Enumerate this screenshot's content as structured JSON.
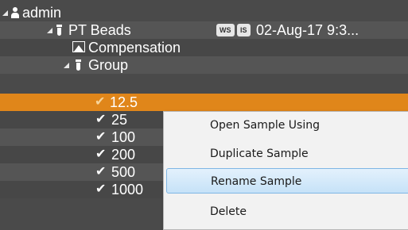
{
  "tree": {
    "root": {
      "label": "admin",
      "icon": "person-icon"
    },
    "experiment": {
      "label": "PT Beads",
      "icon": "tube-icon",
      "badges": [
        "WS",
        "IS"
      ],
      "date": "02-Aug-17 9:3..."
    },
    "compensation": {
      "label": "Compensation",
      "icon": "image-icon"
    },
    "group": {
      "label": "Group",
      "icon": "tube-icon"
    },
    "samples": [
      {
        "label": "12.5",
        "checked": true,
        "selected": true
      },
      {
        "label": "25",
        "checked": true
      },
      {
        "label": "100",
        "checked": true
      },
      {
        "label": "200",
        "checked": true
      },
      {
        "label": "500",
        "checked": true
      },
      {
        "label": "1000",
        "checked": true
      }
    ],
    "check_glyph": "✔"
  },
  "context_menu": {
    "items": [
      {
        "label": "Open Sample Using"
      },
      {
        "label": "Duplicate Sample"
      },
      {
        "label": "Rename Sample",
        "highlighted": true
      },
      {
        "label": "Delete"
      }
    ]
  },
  "colors": {
    "background": "#4a4a4a",
    "selection": "#e0861a",
    "menu_background": "#f2f2f2",
    "menu_highlight": "#c6e2f8"
  }
}
